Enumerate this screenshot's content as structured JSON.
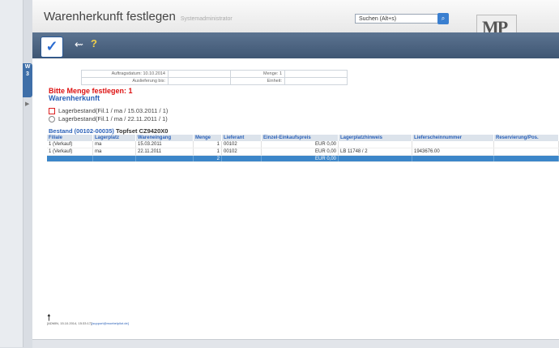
{
  "header": {
    "title": "Warenherkunft festlegen",
    "subtitle": "Systemadministrator",
    "search_placeholder": "Suchen (Alt+s)"
  },
  "logo": {
    "text": "MP",
    "caption": "MÖBELPILOT"
  },
  "side_tab": {
    "letter1": "W",
    "letter2": "3"
  },
  "toolbar": {
    "confirm_icon": "check-icon",
    "back_icon": "back-arrow-icon",
    "help_label": "?"
  },
  "info": {
    "auftragsdatum_label": "Auftragsdatum:",
    "auftragsdatum_value": "10.10.2014",
    "menge_label": "Menge:",
    "menge_value": "1",
    "auslieferung_label": "Auslieferung bis:",
    "auslieferung_value": "",
    "einheit_label": "Einheit:",
    "einheit_value": ""
  },
  "warning": "Bitte Menge festlegen: 1",
  "section_title": "Warenherkunft",
  "options": [
    {
      "label": "Lagerbestand(Fil.1 / ma / 15.03.2011 / 1)",
      "type": "checkbox"
    },
    {
      "label": "Lagerbestand(Fil.1 / ma / 22.11.2011 / 1)",
      "type": "radio"
    }
  ],
  "stock": {
    "title": "Bestand (00102-00035)",
    "article": "Topfset CZ9420X0"
  },
  "grid": {
    "headers": [
      "Filiale",
      "Lagerplatz",
      "Wareneingang",
      "Menge",
      "Lieferant",
      "Einzel-Einkaufspreis",
      "Lagerplatzhinweis",
      "Lieferscheinnummer",
      "Reservierung/Pos."
    ],
    "rows": [
      [
        "1 (Verkauf)",
        "ma",
        "15.03.2011",
        "1",
        "00102",
        "EUR 0,00",
        "",
        "",
        ""
      ],
      [
        "1 (Verkauf)",
        "ma",
        "22.11.2011",
        "1",
        "00102",
        "EUR 0,00",
        "LB 11748 / 2",
        "1943676.00",
        ""
      ]
    ],
    "sum": {
      "menge": "2",
      "preis": "EUR 0,00"
    }
  },
  "footer": {
    "text": "[ADMIN, 15.10.2014, 15:33:17]",
    "link": "[support@moebelpilot.de]"
  }
}
